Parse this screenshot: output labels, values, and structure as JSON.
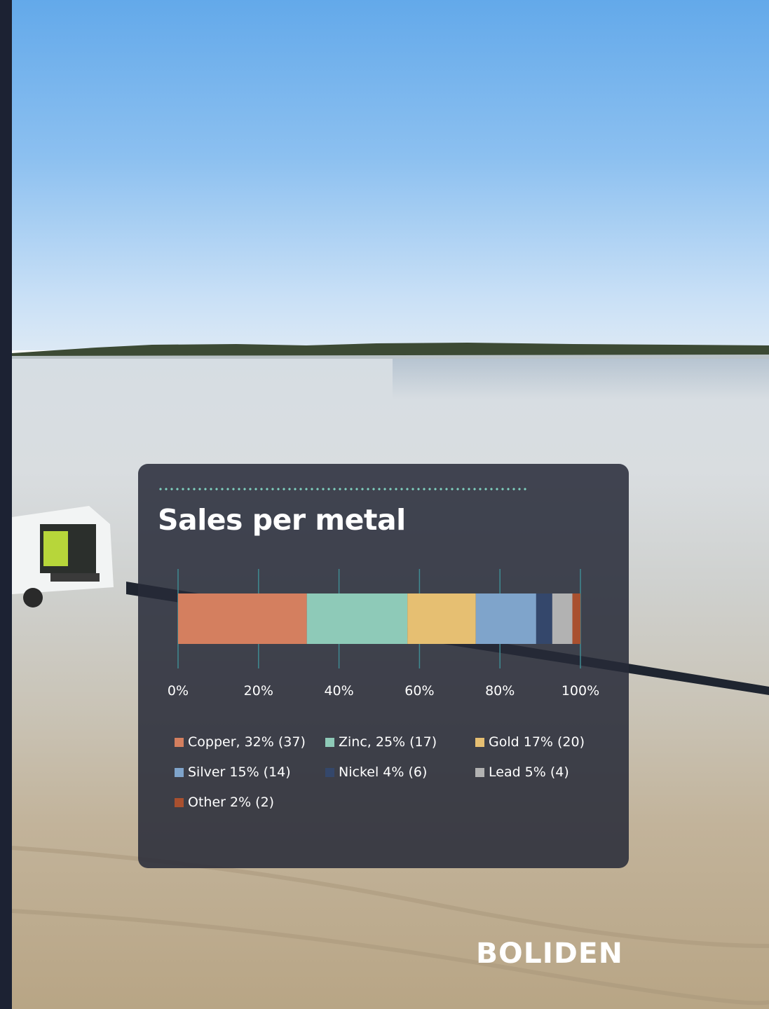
{
  "chart_data": {
    "type": "bar",
    "orientation": "horizontal",
    "stacked": true,
    "title": "Sales per metal",
    "x_ticks": [
      "0%",
      "20%",
      "40%",
      "60%",
      "80%",
      "100%"
    ],
    "xlim": [
      0,
      100
    ],
    "grid": true,
    "legend_position": "bottom",
    "series": [
      {
        "name": "Copper, 32% (37)",
        "value": 32,
        "color": "#d47f5f"
      },
      {
        "name": "Zinc, 25% (17)",
        "value": 25,
        "color": "#8ecab8"
      },
      {
        "name": "Gold 17% (20)",
        "value": 17,
        "color": "#e6bf72"
      },
      {
        "name": "Silver 15% (14)",
        "value": 15,
        "color": "#7fa4cb"
      },
      {
        "name": "Nickel 4% (6)",
        "value": 4,
        "color": "#34476b"
      },
      {
        "name": "Lead 5% (4)",
        "value": 5,
        "color": "#b2b2b2"
      },
      {
        "name": "Other 2% (2)",
        "value": 2,
        "color": "#a9502f"
      }
    ]
  },
  "brand": {
    "logo_text": "BOLIDEN"
  },
  "colors": {
    "panel_bg": "#262a38",
    "gridline": "#3f8a92",
    "dots_accent": "#7fd1c0",
    "side_strip": "#1c2233"
  }
}
